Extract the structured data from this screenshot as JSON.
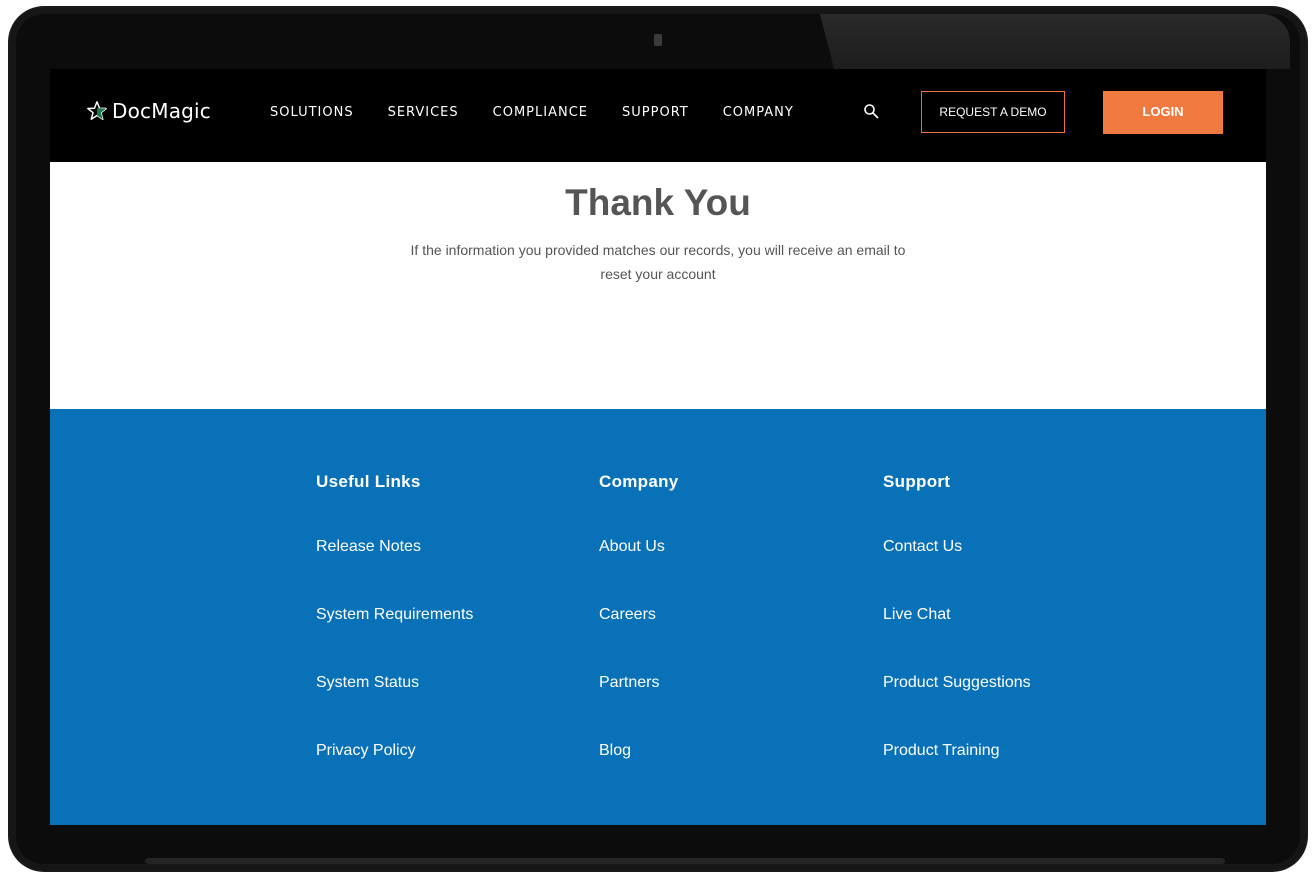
{
  "brand": {
    "name": "DocMagic",
    "logo_icon": "star-icon"
  },
  "nav": {
    "items": [
      {
        "label": "SOLUTIONS"
      },
      {
        "label": "SERVICES"
      },
      {
        "label": "COMPLIANCE"
      },
      {
        "label": "SUPPORT"
      },
      {
        "label": "COMPANY"
      }
    ],
    "search_icon": "search-icon",
    "demo_label": "REQUEST A DEMO",
    "login_label": "LOGIN"
  },
  "main": {
    "title": "Thank You",
    "message": "If the information you provided matches our records, you will receive an email to reset your account"
  },
  "footer": {
    "columns": [
      {
        "heading": "Useful Links",
        "links": [
          "Release Notes",
          "System Requirements",
          "System Status",
          "Privacy Policy"
        ]
      },
      {
        "heading": "Company",
        "links": [
          "About Us",
          "Careers",
          "Partners",
          "Blog"
        ]
      },
      {
        "heading": "Support",
        "links": [
          "Contact Us",
          "Live Chat",
          "Product Suggestions",
          "Product Training"
        ]
      }
    ]
  },
  "colors": {
    "accent_orange": "#f0793f",
    "footer_blue": "#0971b8",
    "logo_star_green": "#1e7a4a",
    "nav_background": "#000000"
  }
}
